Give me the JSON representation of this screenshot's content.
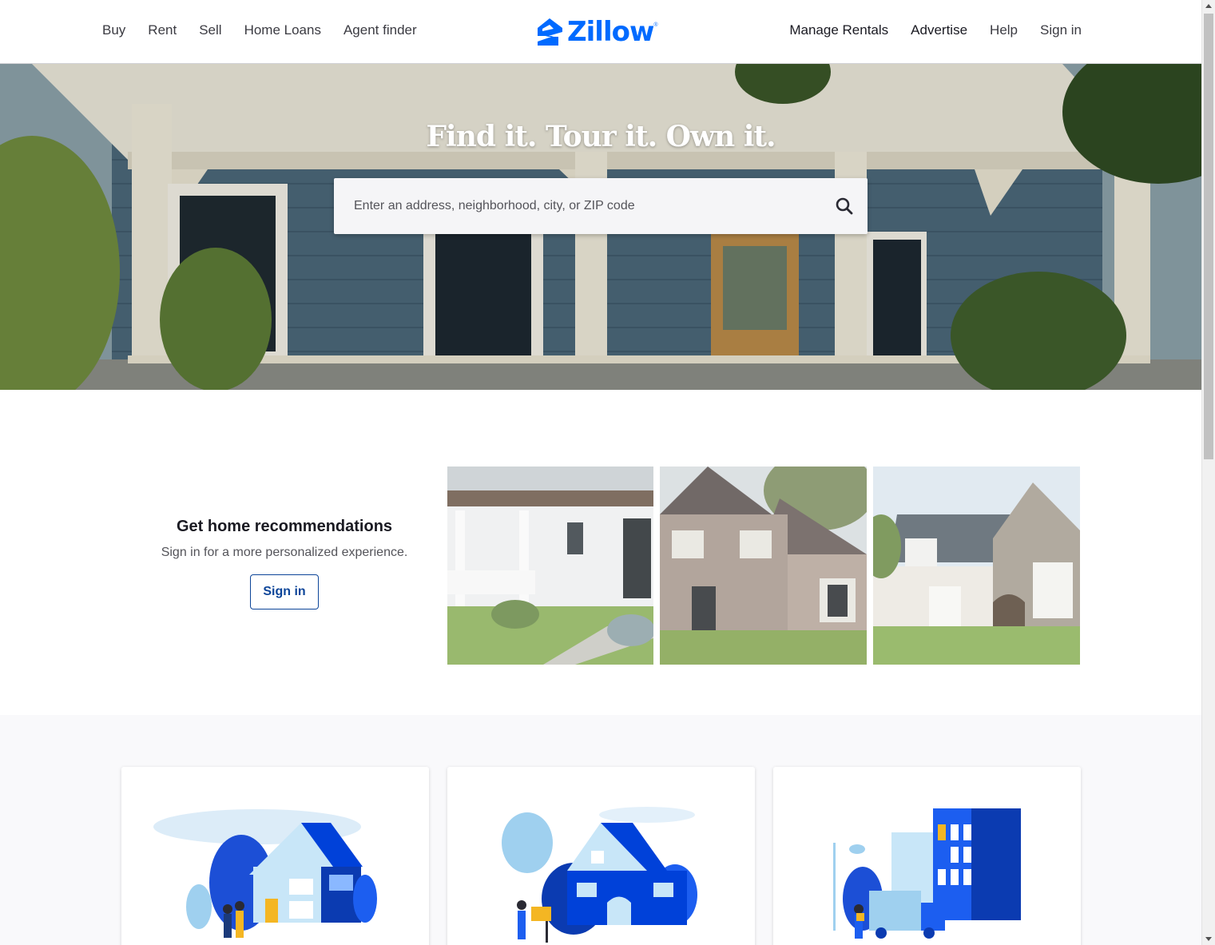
{
  "header": {
    "nav_left": [
      "Buy",
      "Rent",
      "Sell",
      "Home Loans",
      "Agent finder"
    ],
    "logo_text": "Zillow",
    "logo_reg": "®",
    "nav_right": [
      "Manage Rentals",
      "Advertise",
      "Help",
      "Sign in"
    ],
    "brand_color": "#006aff"
  },
  "hero": {
    "title": "Find it. Tour it. Own it.",
    "search_placeholder": "Enter an address, neighborhood, city, or ZIP code",
    "search_icon": "search-icon"
  },
  "recommendations": {
    "title": "Get home recommendations",
    "subtitle": "Sign in for a more personalized experience.",
    "button": "Sign in",
    "button_color": "#0d4599"
  },
  "cards": [
    {
      "illustration": "buy-home-illustration"
    },
    {
      "illustration": "sell-home-illustration"
    },
    {
      "illustration": "rent-home-illustration"
    }
  ]
}
